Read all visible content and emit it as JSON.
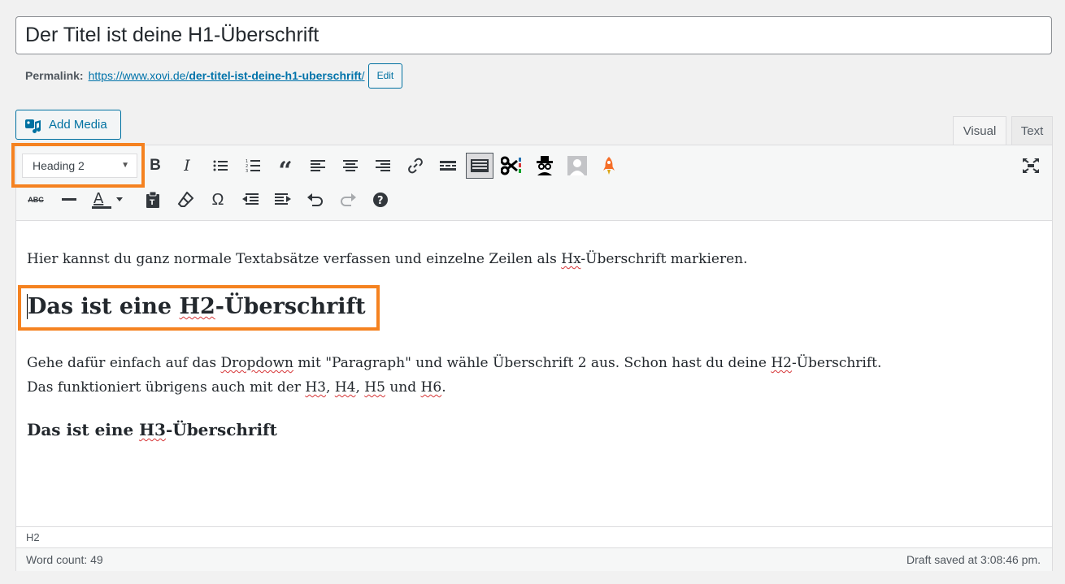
{
  "title": "Der Titel ist deine H1-Überschrift",
  "permalink": {
    "label": "Permalink:",
    "base": "https://www.xovi.de/",
    "slug": "der-titel-ist-deine-h1-uberschrift",
    "suffix": "/",
    "edit_label": "Edit"
  },
  "add_media_label": "Add Media",
  "tabs": {
    "visual": "Visual",
    "text": "Text"
  },
  "toolbar": {
    "format_value": "Heading 2",
    "row1_icons": [
      "bold-icon",
      "italic-icon",
      "bulleted-list-icon",
      "numbered-list-icon",
      "blockquote-icon",
      "align-left-icon",
      "align-center-icon",
      "align-right-icon",
      "link-icon",
      "read-more-icon",
      "toolbar-toggle-icon",
      "scissors-plugin-icon",
      "spy-plugin-icon",
      "avatar-plugin-icon",
      "rocket-plugin-icon",
      "fullscreen-icon"
    ],
    "row2_icons": [
      "strikethrough-icon",
      "horizontal-line-icon",
      "text-color-icon",
      "paste-text-icon",
      "clear-formatting-icon",
      "special-character-icon",
      "outdent-icon",
      "indent-icon",
      "undo-icon",
      "redo-icon",
      "help-icon"
    ]
  },
  "content": {
    "p1_before": "Hier kannst du ganz normale Textabsätze verfassen und einzelne Zeilen als ",
    "p1_hx": "Hx",
    "p1_after": "-Überschrift markieren.",
    "h2_before": "Das ist eine ",
    "h2_mark": "H2",
    "h2_after": "-Überschrift",
    "p2_a": "Gehe dafür einfach auf das ",
    "p2_dropdown": "Dropdown",
    "p2_b": " mit \"Paragraph\" und wähle Überschrift 2 aus. Schon hast du deine ",
    "p2_h2": "H2",
    "p2_c": "-Überschrift.",
    "p3_a": "Das funktioniert übrigens auch mit der ",
    "p3_h3": "H3",
    "p3_sep1": ", ",
    "p3_h4": "H4",
    "p3_sep2": ", ",
    "p3_h5": "H5",
    "p3_und": " und ",
    "p3_h6": "H6",
    "p3_end": ".",
    "h3_before": "Das ist eine ",
    "h3_mark": "H3",
    "h3_after": "-Überschrift"
  },
  "path": "H2",
  "word_count": "Word count: 49",
  "draft_status": "Draft saved at 3:08:46 pm.",
  "colors": {
    "accent": "#0073aa",
    "highlight": "#f58220",
    "spellcheck": "#d63638"
  }
}
